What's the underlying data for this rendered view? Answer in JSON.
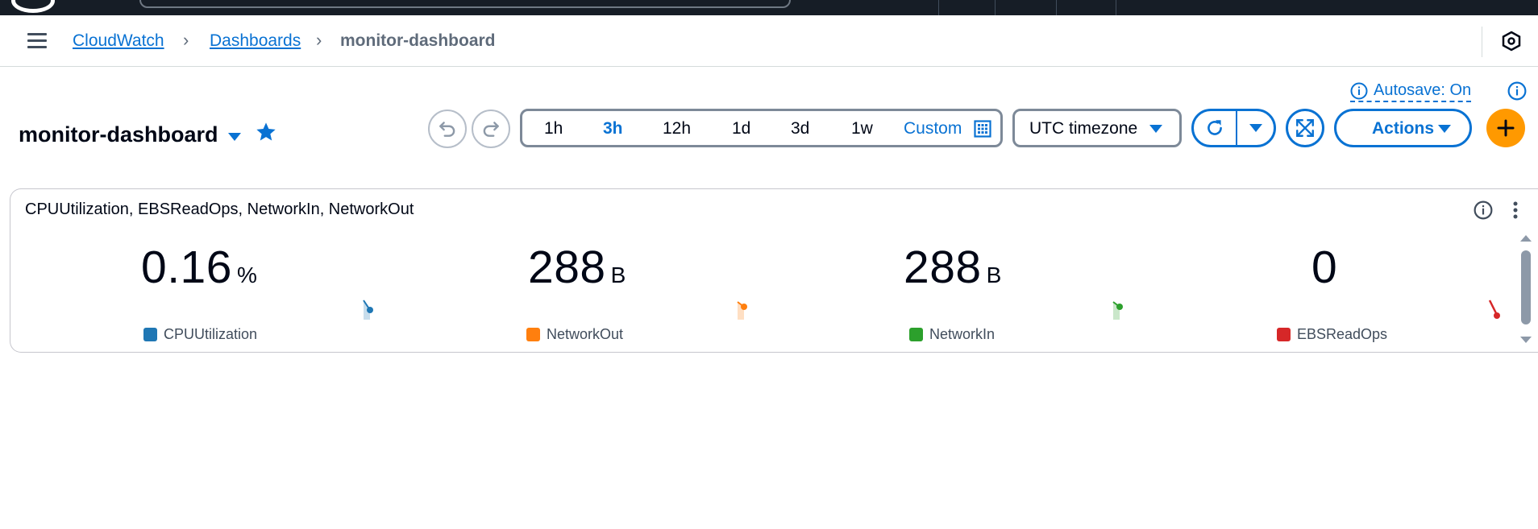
{
  "breadcrumb": {
    "items": [
      "CloudWatch",
      "Dashboards"
    ],
    "current": "monitor-dashboard"
  },
  "header": {
    "title": "monitor-dashboard",
    "autosave": "Autosave: On"
  },
  "time_range": {
    "options": [
      "1h",
      "3h",
      "12h",
      "1d",
      "3d",
      "1w"
    ],
    "selected": "3h",
    "custom_label": "Custom"
  },
  "timezone": {
    "value": "UTC timezone"
  },
  "actions": {
    "label": "Actions"
  },
  "widget": {
    "title": "CPUUtilization, EBSReadOps, NetworkIn, NetworkOut",
    "metrics": [
      {
        "value": "0.16",
        "unit": "%",
        "label": "CPUUtilization",
        "color": "#1f77b4"
      },
      {
        "value": "288",
        "unit": "B",
        "label": "NetworkOut",
        "color": "#ff7f0e"
      },
      {
        "value": "288",
        "unit": "B",
        "label": "NetworkIn",
        "color": "#2ca02c"
      },
      {
        "value": "0",
        "unit": "",
        "label": "EBSReadOps",
        "color": "#d62728"
      }
    ]
  },
  "colors": {
    "accent": "#0972d3",
    "add_button": "#ff9900",
    "topbar": "#161d26"
  }
}
